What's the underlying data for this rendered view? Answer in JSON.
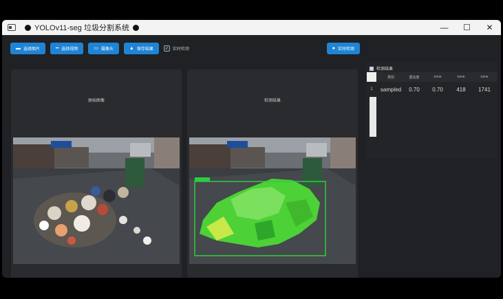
{
  "window": {
    "title": "YOLOv11-seg 垃圾分割系统"
  },
  "titlebar": {
    "minimize": "—",
    "maximize": "☐",
    "close": "✕"
  },
  "toolbar": {
    "buttons": [
      {
        "label": "选择图片",
        "icon": "image-icon"
      },
      {
        "label": "选择视频",
        "icon": "video-icon"
      },
      {
        "label": "摄像头",
        "icon": "camera-icon"
      },
      {
        "label": "保存结果",
        "icon": "save-icon"
      }
    ],
    "checkbox_label": "实时检测",
    "right_button": {
      "label": "实时检测",
      "icon": "play-icon"
    }
  },
  "panels": {
    "left_title": "原始图像",
    "right_title": "检测结果"
  },
  "results": {
    "title": "检测结果",
    "headers": [
      "类别",
      "置信度",
      "none",
      "none",
      "none"
    ],
    "rows": [
      {
        "num": "1",
        "values": [
          "sampled",
          "0.70",
          "0.70",
          "418",
          "1741"
        ]
      }
    ]
  },
  "colors": {
    "accent": "#1f84d6",
    "mask": "#4cd137",
    "bbox": "#2ecc40"
  }
}
